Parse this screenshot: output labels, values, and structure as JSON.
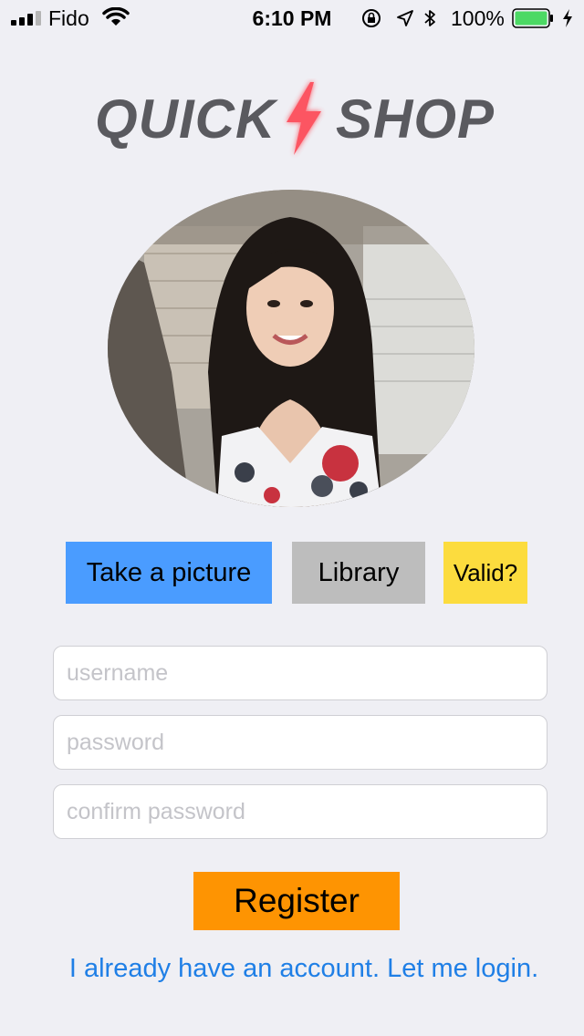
{
  "status_bar": {
    "carrier": "Fido",
    "time": "6:10 PM",
    "battery_percent": "100%",
    "battery_level": 1.0,
    "icons": [
      "signal-bars-icon",
      "wifi-icon",
      "orientation-lock-icon",
      "location-arrow-icon",
      "bluetooth-icon",
      "battery-icon",
      "charging-bolt-icon"
    ]
  },
  "logo": {
    "left_text": "QUICK",
    "right_text": "SHOP",
    "icon": "lightning-bolt-icon",
    "accent_color": "#ff3b4a"
  },
  "profile": {
    "image": "profile-photo"
  },
  "photo_actions": {
    "take_picture_label": "Take a picture",
    "library_label": "Library",
    "valid_label": "Valid?"
  },
  "form": {
    "username_placeholder": "username",
    "password_placeholder": "password",
    "confirm_placeholder": "confirm password",
    "register_label": "Register",
    "login_link": "I already have an account. Let me login."
  },
  "colors": {
    "background": "#efeff4",
    "take_picture": "#4a9cff",
    "library": "#bdbdbd",
    "valid": "#fcdc3e",
    "register": "#fe9402",
    "link": "#1f7fe6"
  }
}
